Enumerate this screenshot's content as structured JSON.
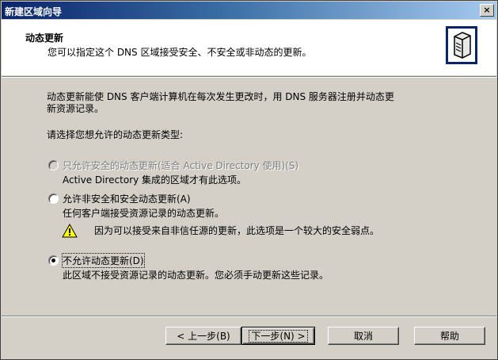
{
  "window": {
    "title": "新建区域向导",
    "close_label": "×"
  },
  "header": {
    "title": "动态更新",
    "subtitle": "您可以指定这个 DNS 区域接受安全、不安全或非动态的更新。",
    "icon": "server-icon"
  },
  "body": {
    "description_line1": "动态更新能使 DNS 客户端计算机在每次发生更改时，用 DNS 服务器注册并动态更",
    "description_line2": "新资源记录。",
    "prompt": "请选择您想允许的动态更新类型:"
  },
  "options": [
    {
      "label": "只允许安全的动态更新(适合 Active Directory 使用)(S)",
      "detail": "Active Directory 集成的区域才有此选项。",
      "selected": false,
      "enabled": false
    },
    {
      "label": "允许非安全和安全动态更新(A)",
      "detail": "任何客户端接受资源记录的动态更新。",
      "warning": "因为可以接受来自非信任源的更新，此选项是一个较大的安全弱点。",
      "selected": false,
      "enabled": true
    },
    {
      "label": "不允许动态更新(D)",
      "detail": "此区域不接受资源记录的动态更新。您必须手动更新这些记录。",
      "selected": true,
      "enabled": true
    }
  ],
  "buttons": {
    "back": "< 上一步(B)",
    "next": "下一步(N) >",
    "cancel": "取消",
    "help": "帮助"
  }
}
